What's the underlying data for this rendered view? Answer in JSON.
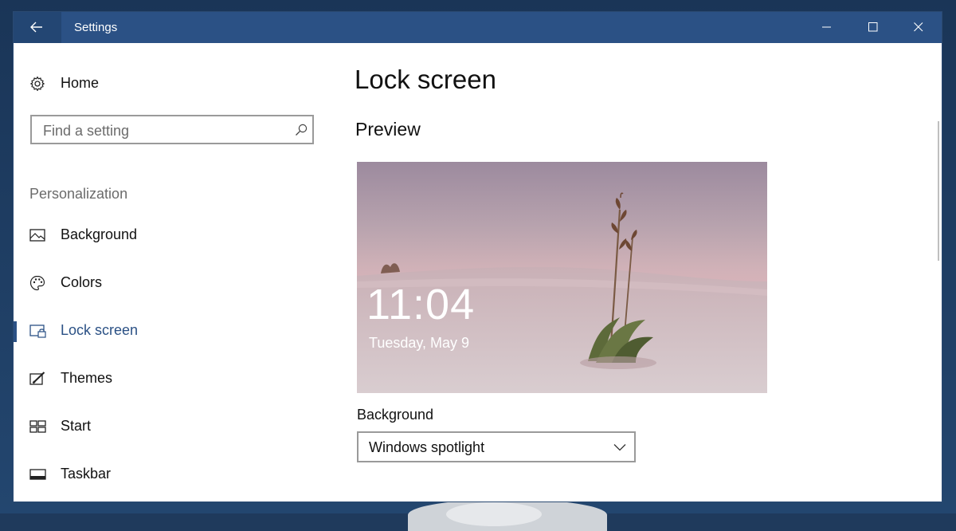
{
  "window": {
    "title": "Settings"
  },
  "nav": {
    "home_label": "Home",
    "search_placeholder": "Find a setting",
    "section_label": "Personalization",
    "items": [
      {
        "label": "Background",
        "icon": "picture-icon"
      },
      {
        "label": "Colors",
        "icon": "palette-icon"
      },
      {
        "label": "Lock screen",
        "icon": "lock-screen-icon",
        "selected": true
      },
      {
        "label": "Themes",
        "icon": "themes-icon"
      },
      {
        "label": "Start",
        "icon": "start-icon"
      },
      {
        "label": "Taskbar",
        "icon": "taskbar-icon"
      }
    ]
  },
  "main": {
    "title": "Lock screen",
    "preview_heading": "Preview",
    "preview": {
      "time": "11:04",
      "date": "Tuesday, May 9"
    },
    "background_label": "Background",
    "background_value": "Windows spotlight"
  },
  "colors": {
    "accent": "#2b5185",
    "titlebar": "#2b5185"
  }
}
